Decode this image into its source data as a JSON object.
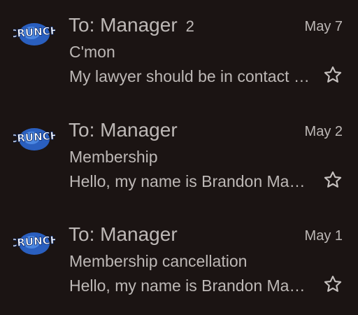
{
  "emails": [
    {
      "sender": "To: Manager",
      "count": "2",
      "date": "May 7",
      "subject": "C'mon",
      "snippet": "My lawyer should be in contact with you",
      "avatar_icon": "crunch-logo",
      "star_icon": "star-outline-icon"
    },
    {
      "sender": "To: Manager",
      "count": "",
      "date": "May 2",
      "subject": "Membership",
      "snippet": "Hello, my name is Brandon Martinez",
      "avatar_icon": "crunch-logo",
      "star_icon": "star-outline-icon"
    },
    {
      "sender": "To: Manager",
      "count": "",
      "date": "May 1",
      "subject": "Membership cancellation",
      "snippet": "Hello, my name is Brandon Martinez",
      "avatar_icon": "crunch-logo",
      "star_icon": "star-outline-icon"
    }
  ],
  "colors": {
    "background": "#1b1413",
    "text": "#bdb8b6",
    "logo_blue": "#2d6fd6"
  }
}
